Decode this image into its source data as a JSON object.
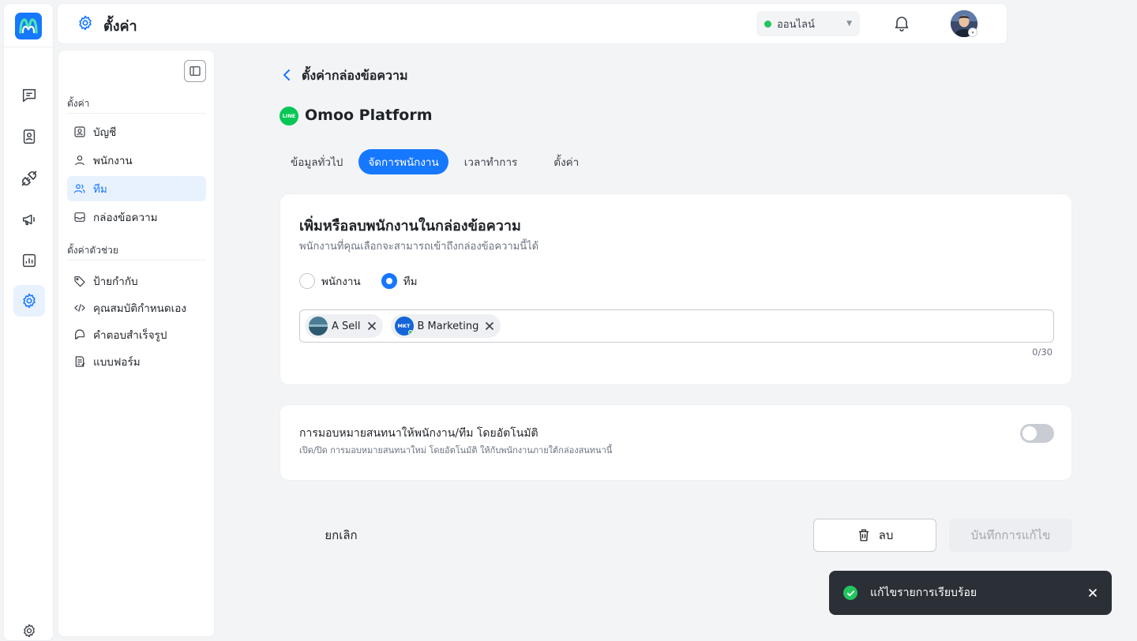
{
  "header": {
    "title": "ตั้งค่า",
    "status": {
      "label": "ออนไลน์",
      "color": "#22c55e"
    }
  },
  "rail": {
    "items": [
      "chat-icon",
      "contacts-icon",
      "plug-icon",
      "megaphone-icon",
      "chart-icon",
      "settings-icon"
    ],
    "active": "settings-icon"
  },
  "sidebar": {
    "section1": "ตั้งค่า",
    "items1": [
      {
        "label": "บัญชี",
        "icon": "account-icon"
      },
      {
        "label": "พนักงาน",
        "icon": "user-icon"
      },
      {
        "label": "ทีม",
        "icon": "team-icon",
        "active": true
      },
      {
        "label": "กล่องข้อความ",
        "icon": "inbox-icon"
      }
    ],
    "section2": "ตั้งค่าตัวช่วย",
    "items2": [
      {
        "label": "ป้ายกำกับ",
        "icon": "tag-icon"
      },
      {
        "label": "คุณสมบัติกำหนดเอง",
        "icon": "code-icon"
      },
      {
        "label": "คำตอบสำเร็จรูป",
        "icon": "quick-reply-icon"
      },
      {
        "label": "แบบฟอร์ม",
        "icon": "form-icon"
      }
    ]
  },
  "page": {
    "title": "ตั้งค่ากล่องข้อความ",
    "platform": {
      "name": "Omoo Platform",
      "logo_text": "LINE"
    },
    "tabs": [
      "ข้อมูลทั่วไป",
      "จัดการพนักงาน",
      "เวลาทำการ",
      "ตั้งค่า"
    ],
    "active_tab": "จัดการพนักงาน"
  },
  "members_card": {
    "title": "เพิ่มหรือลบพนักงานในกล่องข้อความ",
    "subtitle": "พนักงานที่คุณเลือกจะสามารถเข้าถึงกล่องข้อความนี้ได้",
    "radio_employee": "พนักงาน",
    "radio_team": "ทีม",
    "selected": "ทีม",
    "tags": [
      {
        "label": "A Sell"
      },
      {
        "label": "B Marketing",
        "avatar_text": "MKT"
      }
    ],
    "counter": "0/30"
  },
  "auto_assign": {
    "title": "การมอบหมายสนทนาให้พนักงาน/ทีม โดยอัตโนมัติ",
    "subtitle": "เปิด/ปิด การมอบหมายสนทนาใหม่  โดยอัตโนมัติ ให้กับพนักงานภายใต้กล่องสนทนานี้",
    "enabled": false
  },
  "actions": {
    "cancel": "ยกเลิก",
    "delete": "ลบ",
    "save": "บันทึกการแก้ไข"
  },
  "toast": {
    "message": "แก้ไขรายการเรียบร้อย"
  },
  "colors": {
    "accent": "#1677ff",
    "success": "#22c55e",
    "line_green": "#06c755"
  }
}
